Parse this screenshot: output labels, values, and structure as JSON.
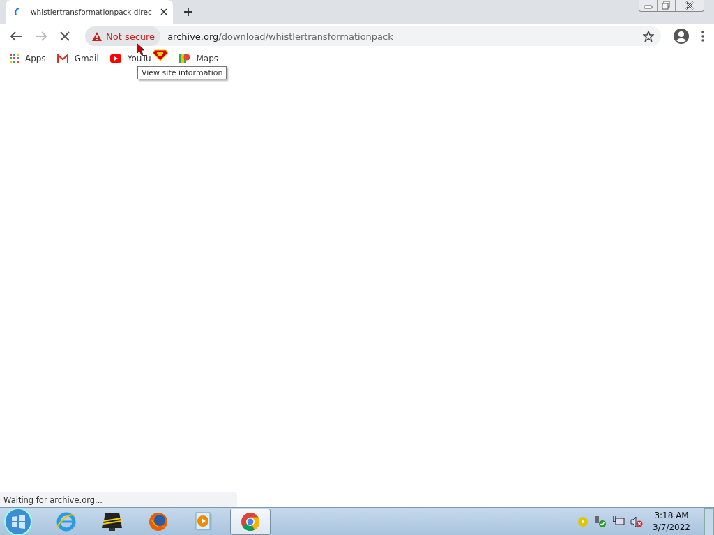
{
  "tab": {
    "title": "whistlertransformationpack direc",
    "loading": true
  },
  "toolbar": {
    "forward_disabled": true
  },
  "address_bar": {
    "security": "Not secure",
    "host": "archive.org",
    "path": "/download/whistlertransformationpack"
  },
  "bookmarks": [
    {
      "kind": "apps",
      "label": "Apps"
    },
    {
      "kind": "gmail",
      "label": "Gmail"
    },
    {
      "kind": "youtube",
      "label": "YouTu"
    },
    {
      "kind": "maps",
      "label": "Maps"
    }
  ],
  "tooltip": "View site information",
  "status": "Waiting for archive.org...",
  "taskbar": {
    "apps": [
      {
        "kind": "ie",
        "selected": false
      },
      {
        "kind": "monitor",
        "selected": false
      },
      {
        "kind": "firefox",
        "selected": false
      },
      {
        "kind": "media",
        "selected": false
      },
      {
        "kind": "chrome",
        "selected": true
      }
    ],
    "clock": {
      "time": "3:18 AM",
      "date": "3/7/2022"
    }
  }
}
